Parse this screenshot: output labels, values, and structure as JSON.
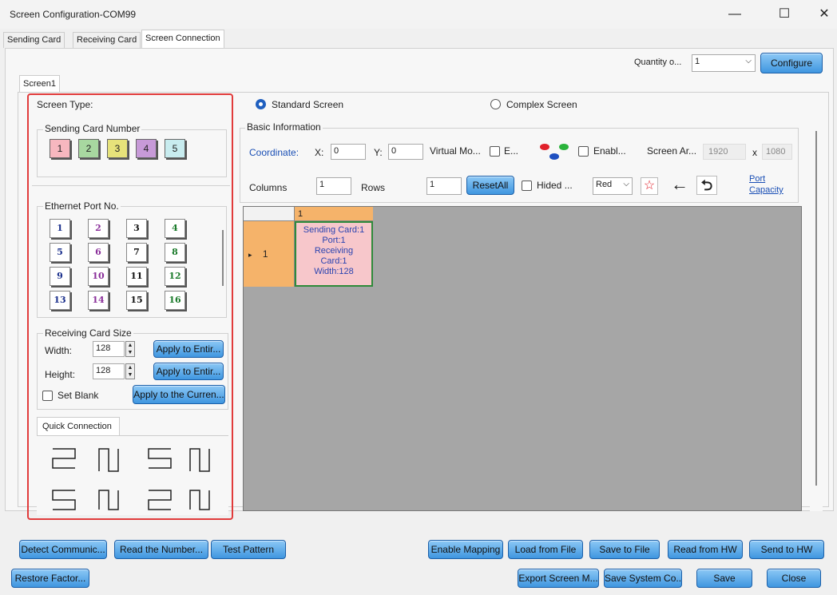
{
  "window": {
    "title": "Screen Configuration-COM99",
    "min": "—",
    "max": "☐",
    "close": "✕"
  },
  "tabs": [
    "Sending Card",
    "Receiving Card",
    "Screen Connection"
  ],
  "top": {
    "quantity_label": "Quantity o...",
    "quantity_value": "1",
    "configure": "Configure"
  },
  "screen_tab": "Screen1",
  "left": {
    "screen_type": "Screen Type:",
    "sending_card_number": "Sending Card Number",
    "sending_cards": [
      {
        "n": "1",
        "color": "#f7b7bf"
      },
      {
        "n": "2",
        "color": "#a8d8a0"
      },
      {
        "n": "3",
        "color": "#e6e27a"
      },
      {
        "n": "4",
        "color": "#c79ad8"
      },
      {
        "n": "5",
        "color": "#c8ecef"
      }
    ],
    "ethernet_port": "Ethernet Port No.",
    "ports": [
      {
        "n": "1",
        "c": "#1a2f8c"
      },
      {
        "n": "2",
        "c": "#8a2f9a"
      },
      {
        "n": "3",
        "c": "#111"
      },
      {
        "n": "4",
        "c": "#1a7a2a"
      },
      {
        "n": "5",
        "c": "#1a2f8c"
      },
      {
        "n": "6",
        "c": "#8a2f9a"
      },
      {
        "n": "7",
        "c": "#111"
      },
      {
        "n": "8",
        "c": "#1a7a2a"
      },
      {
        "n": "9",
        "c": "#1a2f8c"
      },
      {
        "n": "10",
        "c": "#8a2f9a"
      },
      {
        "n": "11",
        "c": "#111"
      },
      {
        "n": "12",
        "c": "#1a7a2a"
      },
      {
        "n": "13",
        "c": "#1a2f8c"
      },
      {
        "n": "14",
        "c": "#8a2f9a"
      },
      {
        "n": "15",
        "c": "#111"
      },
      {
        "n": "16",
        "c": "#1a7a2a"
      }
    ],
    "receiving_card_size": "Receiving Card Size",
    "width_label": "Width:",
    "width_value": "128",
    "height_label": "Height:",
    "height_value": "128",
    "apply_entire_1": "Apply to Entir...",
    "apply_entire_2": "Apply to Entir...",
    "set_blank": "Set Blank",
    "apply_current": "Apply to the Curren...",
    "quick_connection": "Quick Connection"
  },
  "right": {
    "standard_screen": "Standard Screen",
    "complex_screen": "Complex Screen",
    "basic_information": "Basic Information",
    "coordinate": "Coordinate:",
    "x_label": "X:",
    "x_value": "0",
    "y_label": "Y:",
    "y_value": "0",
    "virtual_mode": "Virtual Mo...",
    "e_label": "E...",
    "enable_label": "Enabl...",
    "screen_area": "Screen Ar...",
    "area_w": "1920",
    "area_x": "x",
    "area_h": "1080",
    "columns_label": "Columns",
    "columns_value": "1",
    "rows_label": "Rows",
    "rows_value": "1",
    "reset_all": "ResetAll",
    "hided": "Hided ...",
    "color_select": "Red",
    "port_capacity_1": "Port",
    "port_capacity_2": "Capacity"
  },
  "grid": {
    "col_header": "1",
    "row_header": "1",
    "row_marker": "▸",
    "cell_lines": [
      "Sending Card:1",
      "Port:1",
      "Receiving",
      "Card:1",
      "Width:128"
    ]
  },
  "bottom": {
    "row1": [
      "Detect Communic...",
      "Read the Number...",
      "Test Pattern",
      "Enable Mapping",
      "Load from File",
      "Save to File",
      "Read from HW",
      "Send to HW"
    ],
    "row2": [
      "Restore Factor...",
      "Export Screen M...",
      "Save System Co...",
      "Save",
      "Close"
    ]
  }
}
